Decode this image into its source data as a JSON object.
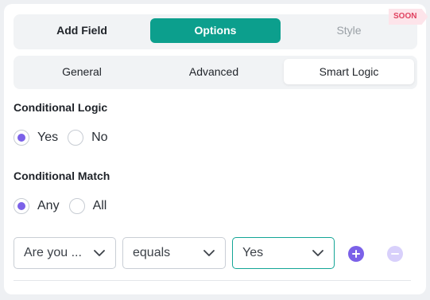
{
  "top_tabs": {
    "add_field": "Add Field",
    "options": "Options",
    "style": "Style",
    "soon_badge": "SOON"
  },
  "sub_tabs": {
    "general": "General",
    "advanced": "Advanced",
    "smart_logic": "Smart Logic"
  },
  "conditional_logic": {
    "title": "Conditional Logic",
    "options": [
      "Yes",
      "No"
    ],
    "selected": "Yes"
  },
  "conditional_match": {
    "title": "Conditional Match",
    "options": [
      "Any",
      "All"
    ],
    "selected": "Any"
  },
  "condition_row": {
    "field_value": "Are you ...",
    "operator_value": "equals",
    "value_value": "Yes"
  },
  "colors": {
    "accent_green": "#0c9f8d",
    "radio_purple": "#7b61e8",
    "soon_pink": "#e0405f"
  },
  "icons": {
    "add": "plus-circle-icon",
    "remove": "minus-circle-icon",
    "dropdown": "chevron-down-icon"
  }
}
